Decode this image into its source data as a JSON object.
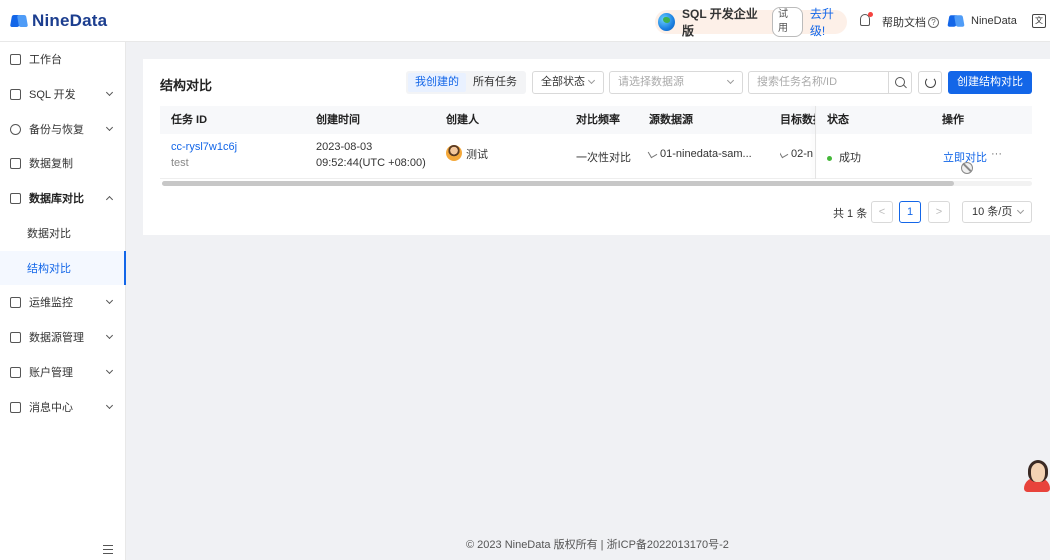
{
  "brand": {
    "name": "NineData"
  },
  "header": {
    "edition": "SQL 开发企业版",
    "trial_badge": "试用",
    "upgrade_link": "去升级!",
    "help": "帮助文档",
    "user": "NineData"
  },
  "sidebar": {
    "items": [
      {
        "label": "工作台",
        "icon": "home-icon"
      },
      {
        "label": "SQL 开发",
        "icon": "terminal-icon"
      },
      {
        "label": "备份与恢复",
        "icon": "cloud-icon"
      },
      {
        "label": "数据复制",
        "icon": "copy-icon"
      },
      {
        "label": "数据库对比",
        "icon": "db-compare-icon"
      },
      {
        "label": "数据对比",
        "icon": ""
      },
      {
        "label": "结构对比",
        "icon": ""
      },
      {
        "label": "运维监控",
        "icon": "monitor-icon"
      },
      {
        "label": "数据源管理",
        "icon": "datasource-icon"
      },
      {
        "label": "账户管理",
        "icon": "account-icon"
      },
      {
        "label": "消息中心",
        "icon": "mail-icon"
      }
    ],
    "active": "结构对比"
  },
  "page": {
    "title": "结构对比",
    "filter_tabs": [
      "我创建的",
      "所有任务"
    ],
    "active_tab": "我创建的",
    "status_select": "全部状态",
    "datasource_placeholder": "请选择数据源",
    "search_placeholder": "搜索任务名称/ID",
    "create_button": "创建结构对比"
  },
  "table": {
    "headers": [
      "任务 ID",
      "创建时间",
      "创建人",
      "对比频率",
      "源数据源",
      "目标数据",
      "状态",
      "操作"
    ],
    "rows": [
      {
        "task_id": "cc-rysl7w1c6j",
        "task_name": "test",
        "created_date": "2023-08-03",
        "created_time": "09:52:44(UTC +08:00)",
        "creator": "测试",
        "frequency": "一次性对比",
        "source": "01-ninedata-sam...",
        "target": "02-n",
        "status": "成功",
        "action": "立即对比",
        "more": "···"
      }
    ]
  },
  "pagination": {
    "total": "共 1 条",
    "page": "1",
    "page_size": "10 条/页",
    "prev": "<",
    "next": ">"
  },
  "footer": {
    "copyright": "© 2023 NineData 版权所有 | 浙ICP备2022013170号-2"
  },
  "colors": {
    "primary": "#1366e8",
    "success": "#45b83a"
  }
}
